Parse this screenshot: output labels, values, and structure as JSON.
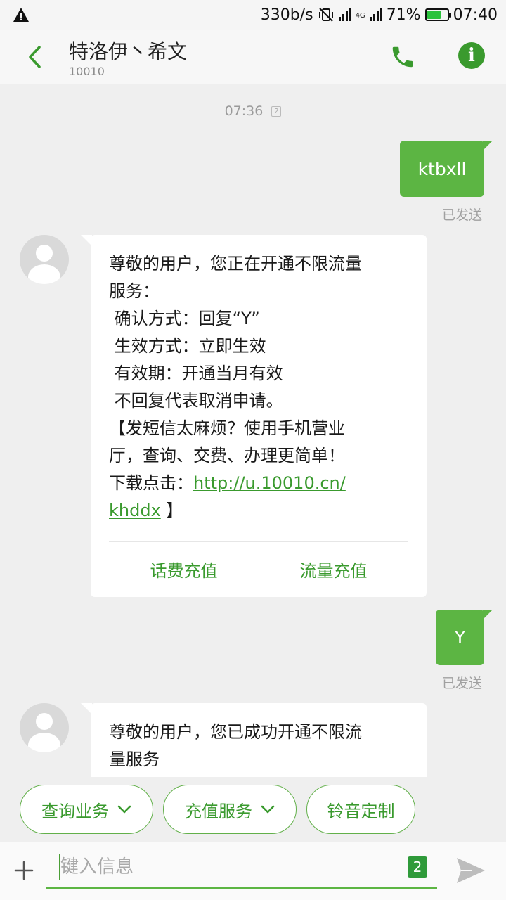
{
  "status_bar": {
    "speed": "330b/s",
    "network": "4G",
    "battery": "71%",
    "battery_level": 0.71,
    "time": "07:40"
  },
  "header": {
    "contact_name": "特洛伊丶希文",
    "contact_number": "10010",
    "info_glyph": "i"
  },
  "conversation": {
    "timestamp": "07:36",
    "sim_indicator": "2",
    "messages": [
      {
        "direction": "out",
        "text": "ktbxll",
        "status": "已发送"
      },
      {
        "direction": "in",
        "text": "尊敬的用户，您正在开通不限流量\n服务：\n 确认方式：回复“Y”\n 生效方式：立即生效\n 有效期：开通当月有效\n 不回复代表取消申请。\n【发短信太麻烦？使用手机营业\n厅，查询、交费、办理更简单！\n下载点击：",
        "link": "http://u.10010.cn/\nkhddx",
        "tail": " 】",
        "actions": [
          "话费充值",
          "流量充值"
        ]
      },
      {
        "direction": "out",
        "text": "Y",
        "status": "已发送"
      },
      {
        "direction": "in",
        "text": "尊敬的用户，您已成功开通不限流\n量服务"
      }
    ]
  },
  "quick_menu": [
    {
      "label": "查询业务",
      "has_dropdown": true
    },
    {
      "label": "充值服务",
      "has_dropdown": true
    },
    {
      "label": "铃音定制",
      "has_dropdown": false
    }
  ],
  "input_bar": {
    "placeholder": "键入信息",
    "sim_badge": "2"
  },
  "colors": {
    "accent": "#3a9a2e",
    "bubble_out": "#5cb543",
    "background": "#efefef"
  },
  "icons": {
    "status_left": "warning-icon",
    "back": "chevron-left-icon",
    "call": "phone-icon",
    "info": "info-icon",
    "add": "plus-icon",
    "send": "send-icon",
    "dropdown": "chevron-down-icon"
  }
}
